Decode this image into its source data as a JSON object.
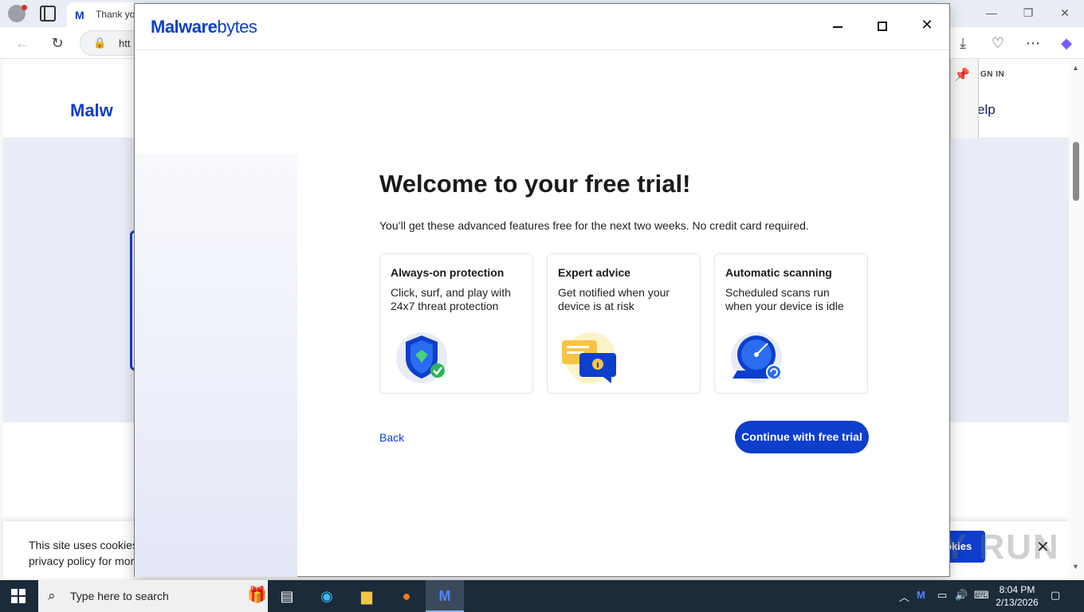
{
  "browser": {
    "tab_title": "Thank yo",
    "tab_logo": "M",
    "url": "htt",
    "page_logo": "Malw",
    "sign_in": "GN IN",
    "help": "elp",
    "cookie_text": "This site uses cookies i privacy policy for more",
    "cookie_button": "okies",
    "watermark": "ANY RUN",
    "icons": [
      "profile-icon",
      "tabs-icon",
      "back-icon",
      "refresh-icon",
      "lock-icon",
      "download-icon",
      "extensions-icon",
      "more-icon",
      "copilot-icon",
      "pin-icon",
      "close-icon"
    ]
  },
  "modal": {
    "logo_bold": "Malware",
    "logo_light": "bytes",
    "title": "Welcome to your free trial!",
    "subtitle": "You’ll get these advanced features free for the next two weeks. No credit card required.",
    "features": [
      {
        "title": "Always-on protection",
        "desc": "Click, surf, and play with 24x7 threat protection",
        "icon": "shield-check-icon"
      },
      {
        "title": "Expert advice",
        "desc": "Get notified when your device is at risk",
        "icon": "chat-info-icon"
      },
      {
        "title": "Automatic scanning",
        "desc": "Scheduled scans run when your device is idle",
        "icon": "radar-scan-icon"
      }
    ],
    "back_label": "Back",
    "cta_label": "Continue with free trial",
    "colors": {
      "brand": "#0d3ecc",
      "title": "#1a1a1a"
    }
  },
  "taskbar": {
    "search_placeholder": "Type here to search",
    "time": "8:04 PM",
    "date": "2/13/2026",
    "apps": [
      "task-view-icon",
      "edge-icon",
      "file-explorer-icon",
      "firefox-icon",
      "malwarebytes-icon"
    ]
  }
}
